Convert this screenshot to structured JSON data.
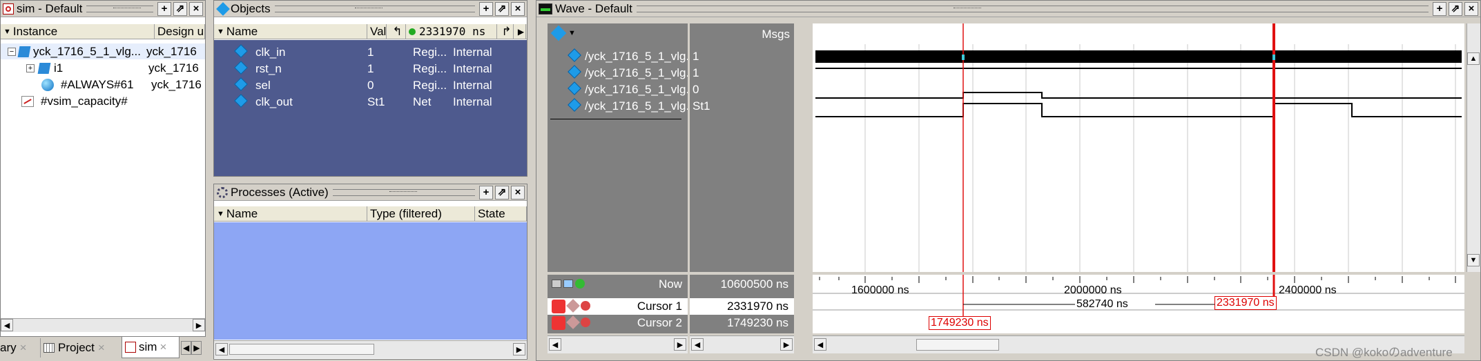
{
  "sim": {
    "title": "sim - Default",
    "col_instance": "Instance",
    "col_design": "Design un",
    "rows": [
      {
        "name": "yck_1716_5_1_vlg...",
        "design": "yck_1716"
      },
      {
        "name": "i1",
        "design": "yck_1716"
      },
      {
        "name": "#ALWAYS#61",
        "design": "yck_1716"
      },
      {
        "name": "#vsim_capacity#",
        "design": ""
      }
    ]
  },
  "tabs": [
    {
      "label": "ary"
    },
    {
      "label": "Project"
    },
    {
      "label": "sim"
    }
  ],
  "objects": {
    "title": "Objects",
    "col_name": "Name",
    "col_val": "Val",
    "time": "2331970 ns",
    "rows": [
      {
        "name": "clk_in",
        "val": "1",
        "kind": "Regi...",
        "mode": "Internal"
      },
      {
        "name": "rst_n",
        "val": "1",
        "kind": "Regi...",
        "mode": "Internal"
      },
      {
        "name": "sel",
        "val": "0",
        "kind": "Regi...",
        "mode": "Internal"
      },
      {
        "name": "clk_out",
        "val": "St1",
        "kind": "Net",
        "mode": "Internal"
      }
    ]
  },
  "processes": {
    "title": "Processes (Active)",
    "col_name": "Name",
    "col_type": "Type (filtered)",
    "col_state": "State"
  },
  "wave": {
    "title": "Wave - Default",
    "msgs": "Msgs",
    "signals": [
      {
        "name": "/yck_1716_5_1_vlg...",
        "val": "1"
      },
      {
        "name": "/yck_1716_5_1_vlg...",
        "val": "1"
      },
      {
        "name": "/yck_1716_5_1_vlg...",
        "val": "0"
      },
      {
        "name": "/yck_1716_5_1_vlg...",
        "val": "St1"
      }
    ],
    "now_label": "Now",
    "now_value": "10600500 ns",
    "cursor1_label": "Cursor 1",
    "cursor1_value": "2331970 ns",
    "cursor2_label": "Cursor 2",
    "cursor2_value": "1749230 ns",
    "tick_1600": "1600000 ns",
    "tick_2000": "2000000 ns",
    "tick_2400": "2400000 ns",
    "delta": "582740 ns",
    "c1_tag": "2331970 ns",
    "c2_tag": "1749230 ns"
  },
  "watermark": "CSDN @kokoのadventure"
}
